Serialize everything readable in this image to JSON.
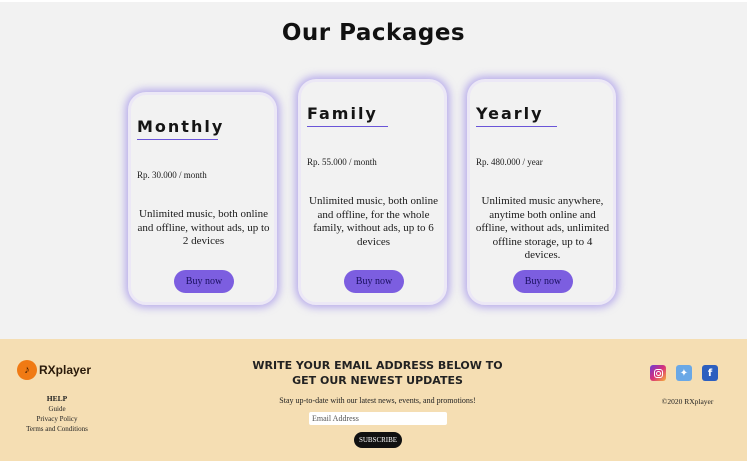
{
  "page": {
    "title": "Our Packages"
  },
  "packages": [
    {
      "name": "Monthly",
      "price": "Rp. 30.000 / month",
      "description": "Unlimited music, both online and offline, without ads, up to 2 devices",
      "button": "Buy now"
    },
    {
      "name": "Family",
      "price": "Rp. 55.000 / month",
      "description": "Unlimited music, both online and offline, for the whole family, without ads, up to 6 devices",
      "button": "Buy now"
    },
    {
      "name": "Yearly",
      "price": "Rp. 480.000 / year",
      "description": "Unlimited music anywhere, anytime both online and offline, without ads, unlimited offline storage, up to 4 devices.",
      "button": "Buy now"
    }
  ],
  "footer": {
    "brand": "RXplayer",
    "help": {
      "title": "HELP",
      "links": [
        "Guide",
        "Privacy Policy",
        "Terms and Conditions"
      ]
    },
    "newsletter": {
      "title": "WRITE YOUR EMAIL ADDRESS BELOW TO GET OUR NEWEST UPDATES",
      "subtitle": "Stay up-to-date with our latest news, events, and promotions!",
      "placeholder": "Email Address",
      "button": "SUBSCRIBE"
    },
    "social": {
      "icons": [
        "instagram-icon",
        "twitter-icon",
        "facebook-icon"
      ]
    },
    "copyright": "©2020 RXplayer"
  },
  "colors": {
    "accent": "#7c5ee0",
    "footer_bg": "#f5deb3",
    "page_bg": "#f2f2f2"
  }
}
